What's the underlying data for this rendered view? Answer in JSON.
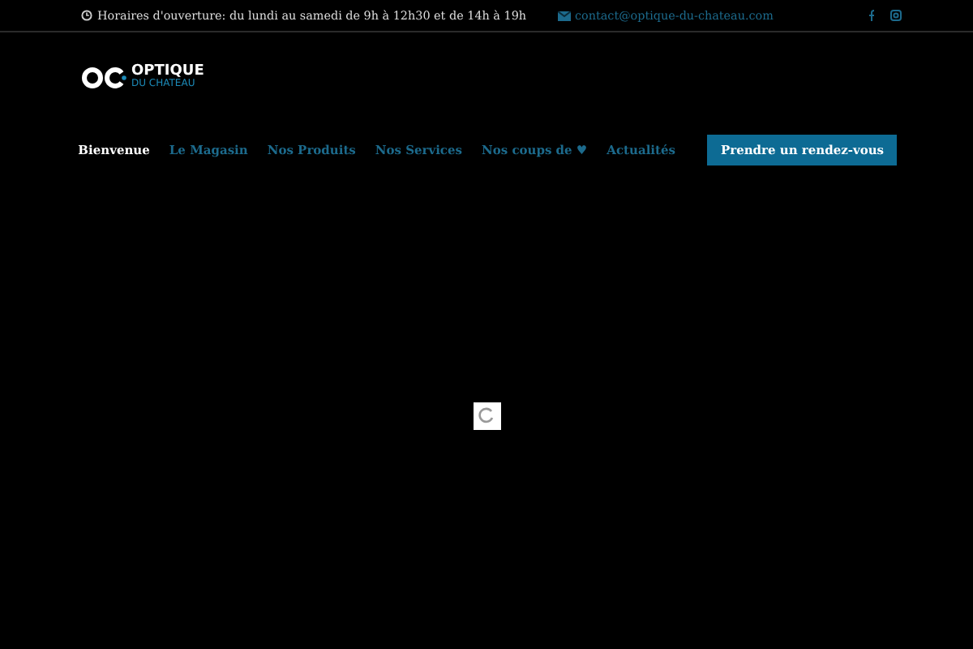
{
  "topbar": {
    "hours": "Horaires d'ouverture: du lundi au samedi de 9h à 12h30 et de 14h à 19h",
    "email": "contact@optique-du-chateau.com"
  },
  "logo": {
    "name": "OPTIQUE",
    "subtitle": "DU CHATEAU"
  },
  "nav": [
    {
      "label": "Bienvenue",
      "selected": true
    },
    {
      "label": "Le Magasin",
      "selected": false
    },
    {
      "label": "Nos Produits",
      "selected": false
    },
    {
      "label": "Nos Services",
      "selected": false
    },
    {
      "label": "Nos coups de ♥",
      "selected": false
    },
    {
      "label": "Actualités",
      "selected": false
    }
  ],
  "cta": "Prendre un rendez-vous"
}
